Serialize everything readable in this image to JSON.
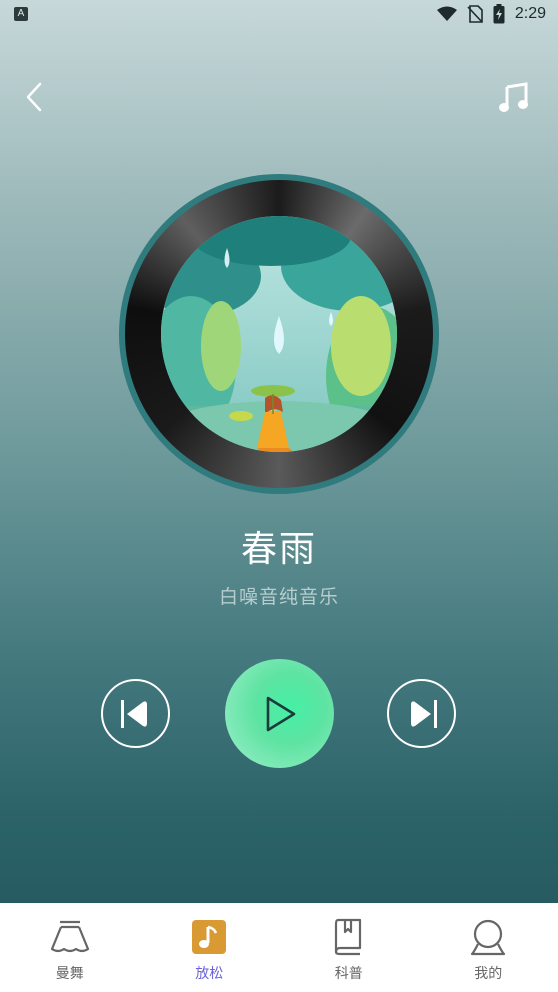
{
  "status_bar": {
    "time": "2:29",
    "notification_letter": "A",
    "icons": [
      "wifi-icon",
      "no-sim-icon",
      "battery-charging-icon"
    ]
  },
  "header": {
    "back_icon": "chevron-left-icon",
    "playlist_icon": "music-note-icon"
  },
  "player": {
    "title": "春雨",
    "subtitle": "白噪音纯音乐",
    "controls": {
      "prev_icon": "skip-previous-icon",
      "play_icon": "play-icon",
      "next_icon": "skip-next-icon"
    },
    "accent_color": "#5ee3a2"
  },
  "tabbar": {
    "tabs": [
      {
        "label": "曼舞",
        "icon": "skirt-icon",
        "active": false
      },
      {
        "label": "放松",
        "icon": "music-note-icon",
        "active": true
      },
      {
        "label": "科普",
        "icon": "book-icon",
        "active": false
      },
      {
        "label": "我的",
        "icon": "user-icon",
        "active": false
      }
    ],
    "active_color": "#6b63d6"
  }
}
